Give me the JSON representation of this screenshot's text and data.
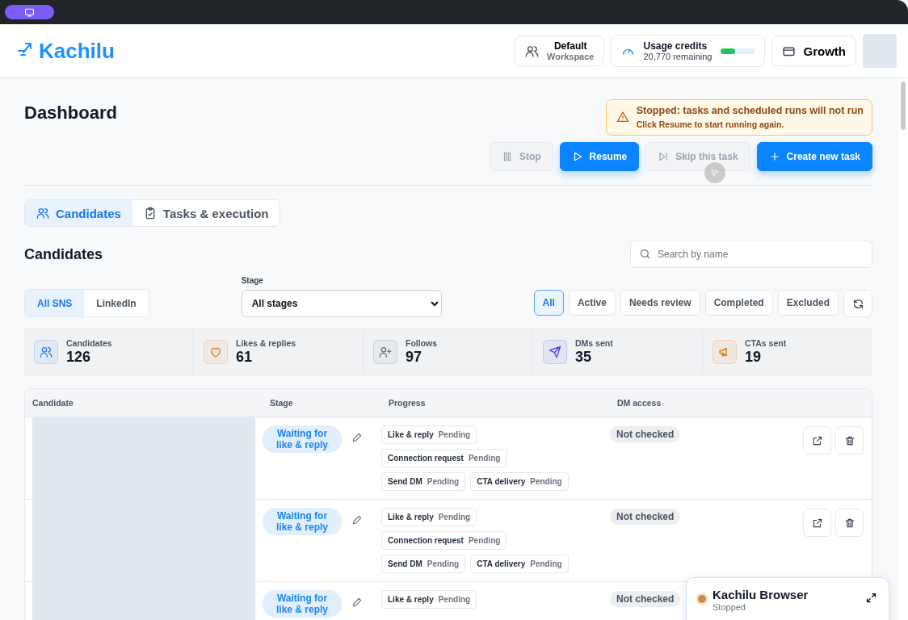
{
  "header": {
    "brand": "Kachilu",
    "workspace": {
      "title": "Default",
      "subtitle": "Workspace"
    },
    "usage": {
      "title": "Usage credits",
      "remaining": "20,770 remaining",
      "level": 0.45
    },
    "plan": "Growth"
  },
  "page": {
    "title": "Dashboard",
    "alert": {
      "title": "Stopped: tasks and scheduled runs will not run",
      "message": "Click Resume to start running again."
    },
    "actions": [
      {
        "kind": "stop",
        "label": "Stop",
        "disabled": true
      },
      {
        "kind": "resume",
        "label": "Resume",
        "disabled": false
      },
      {
        "kind": "skip",
        "label": "Skip this task",
        "disabled": true
      },
      {
        "kind": "create",
        "label": "Create new task",
        "disabled": false
      }
    ]
  },
  "tabs": [
    {
      "kind": "people",
      "label": "Candidates",
      "selected": true
    },
    {
      "kind": "clipboard",
      "label": "Tasks & execution",
      "selected": false
    }
  ],
  "section": {
    "title": "Candidates",
    "search": {
      "placeholder": "Search by name"
    },
    "networks": [
      {
        "label": "All SNS",
        "selected": true
      },
      {
        "label": "LinkedIn",
        "selected": false
      }
    ],
    "stage": {
      "label": "Stage",
      "value": "All stages"
    },
    "filters": [
      {
        "label": "All",
        "selected": true
      },
      {
        "label": "Active",
        "selected": false
      },
      {
        "label": "Needs review",
        "selected": false
      },
      {
        "label": "Completed",
        "selected": false
      },
      {
        "label": "Excluded",
        "selected": false
      }
    ]
  },
  "stats": [
    {
      "kind": "people",
      "label": "Candidates",
      "value": "126",
      "color": "#2f80ed"
    },
    {
      "kind": "heart",
      "label": "Likes & replies",
      "value": "61",
      "color": "#d9822b"
    },
    {
      "kind": "follow",
      "label": "Follows",
      "value": "97",
      "color": "#6b7280"
    },
    {
      "kind": "send",
      "label": "DMs sent",
      "value": "35",
      "color": "#4f46e5"
    },
    {
      "kind": "megaphone",
      "label": "CTAs sent",
      "value": "19",
      "color": "#d97706"
    }
  ],
  "table": {
    "columns": [
      "Candidate",
      "Stage",
      "Progress",
      "DM access"
    ],
    "rows": [
      {
        "stage": "Waiting for like & reply",
        "dm_access": "Not checked",
        "buttons": [
          {
            "kind": "open"
          },
          {
            "kind": "delete"
          }
        ],
        "progress": [
          {
            "label": "Like & reply",
            "status": "Pending"
          },
          {
            "label": "Connection request",
            "status": "Pending"
          },
          {
            "label": "Send DM",
            "status": "Pending"
          },
          {
            "label": "CTA delivery",
            "status": "Pending"
          }
        ]
      },
      {
        "stage": "Waiting for like & reply",
        "dm_access": "Not checked",
        "buttons": [
          {
            "kind": "open"
          },
          {
            "kind": "delete"
          }
        ],
        "progress": [
          {
            "label": "Like & reply",
            "status": "Pending"
          },
          {
            "label": "Connection request",
            "status": "Pending"
          },
          {
            "label": "Send DM",
            "status": "Pending"
          },
          {
            "label": "CTA delivery",
            "status": "Pending"
          }
        ]
      },
      {
        "stage": "Waiting for like & reply",
        "dm_access": "Not checked",
        "progress": [
          {
            "label": "Like & reply",
            "status": "Pending"
          }
        ]
      }
    ]
  },
  "browser_widget": {
    "title": "Kachilu Browser",
    "status": "Stopped"
  }
}
